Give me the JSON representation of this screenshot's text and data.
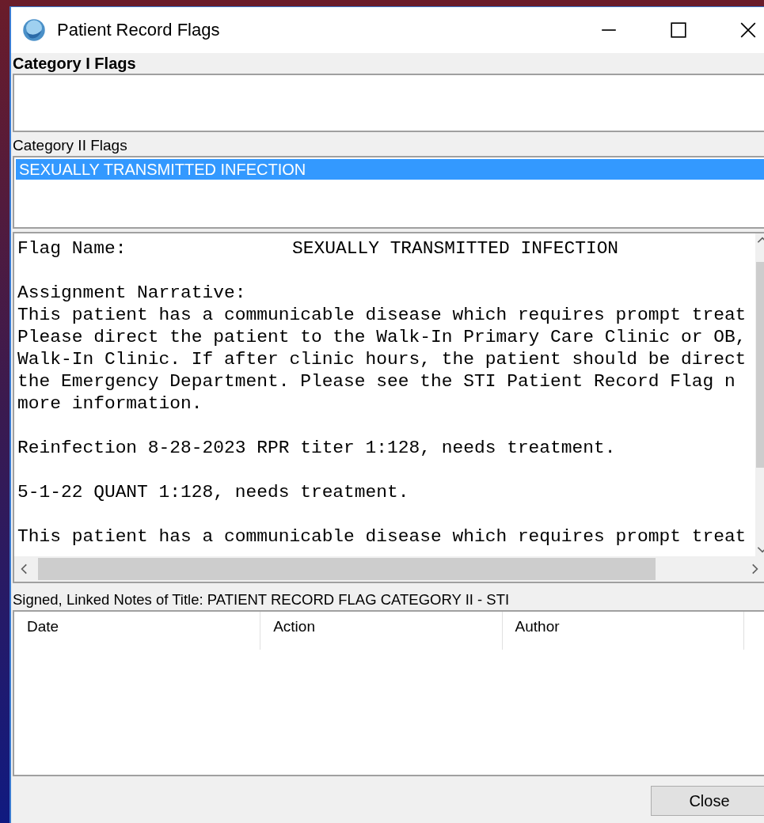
{
  "window": {
    "title": "Patient Record Flags"
  },
  "category_1": {
    "label": "Category I Flags"
  },
  "category_2": {
    "label": "Category II Flags",
    "items": [
      {
        "label": "SEXUALLY TRANSMITTED INFECTION",
        "selected": true
      }
    ]
  },
  "details": {
    "flag_name_label": "Flag Name:",
    "flag_name": "SEXUALLY TRANSMITTED INFECTION",
    "narrative_label": "Assignment Narrative:",
    "paragraphs": [
      [
        "This patient has a communicable disease which requires prompt treat",
        "Please direct the patient to the Walk-In Primary Care Clinic or OB,",
        "Walk-In Clinic. If after clinic hours, the patient should be direct",
        "the Emergency Department. Please see the STI Patient Record Flag n",
        "more information."
      ],
      [
        "Reinfection 8-28-2023 RPR titer 1:128, needs treatment."
      ],
      [
        "5-1-22 QUANT 1:128, needs treatment."
      ],
      [
        "This patient has a communicable disease which requires prompt treat"
      ]
    ]
  },
  "notes": {
    "label": "Signed, Linked Notes of Title: PATIENT RECORD FLAG CATEGORY II - STI",
    "columns": [
      "Date",
      "Action",
      "Author"
    ]
  },
  "buttons": [
    "Close"
  ]
}
